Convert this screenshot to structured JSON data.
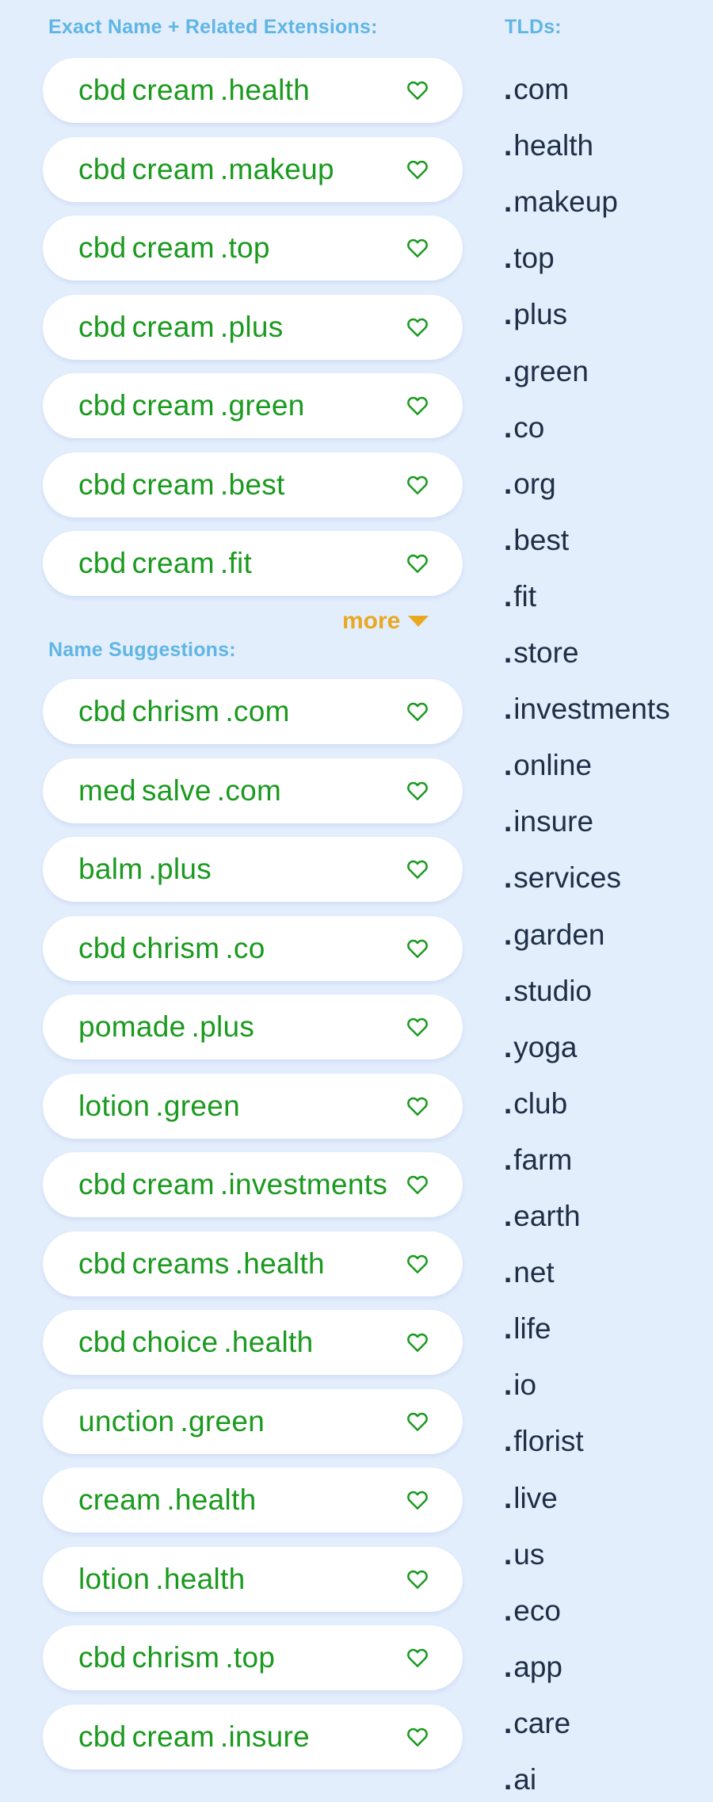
{
  "exact_section": {
    "heading": "Exact Name + Related Extensions:",
    "items": [
      {
        "name": "cbd",
        "name2": "cream",
        "ext": ".health"
      },
      {
        "name": "cbd",
        "name2": "cream",
        "ext": ".makeup"
      },
      {
        "name": "cbd",
        "name2": "cream",
        "ext": ".top"
      },
      {
        "name": "cbd",
        "name2": "cream",
        "ext": ".plus"
      },
      {
        "name": "cbd",
        "name2": "cream",
        "ext": ".green"
      },
      {
        "name": "cbd",
        "name2": "cream",
        "ext": ".best"
      },
      {
        "name": "cbd",
        "name2": "cream",
        "ext": ".fit"
      }
    ],
    "more_label": "more"
  },
  "suggestions_section": {
    "heading": "Name Suggestions:",
    "items": [
      {
        "name": "cbd",
        "name2": "chrism",
        "ext": ".com"
      },
      {
        "name": "med",
        "name2": "salve",
        "ext": ".com"
      },
      {
        "name": "balm",
        "name2": "",
        "ext": ".plus"
      },
      {
        "name": "cbd",
        "name2": "chrism",
        "ext": ".co"
      },
      {
        "name": "pomade",
        "name2": "",
        "ext": ".plus"
      },
      {
        "name": "lotion",
        "name2": "",
        "ext": ".green"
      },
      {
        "name": "cbd",
        "name2": "cream",
        "ext": ".investments"
      },
      {
        "name": "cbd",
        "name2": "creams",
        "ext": ".health"
      },
      {
        "name": "cbd",
        "name2": "choice",
        "ext": ".health"
      },
      {
        "name": "unction",
        "name2": "",
        "ext": ".green"
      },
      {
        "name": "cream",
        "name2": "",
        "ext": ".health"
      },
      {
        "name": "lotion",
        "name2": "",
        "ext": ".health"
      },
      {
        "name": "cbd",
        "name2": "chrism",
        "ext": ".top"
      },
      {
        "name": "cbd",
        "name2": "cream",
        "ext": ".insure"
      }
    ]
  },
  "tlds_section": {
    "heading": "TLDs:",
    "dot": ".",
    "items": [
      "com",
      "health",
      "makeup",
      "top",
      "plus",
      "green",
      "co",
      "org",
      "best",
      "fit",
      "store",
      "investments",
      "online",
      "insure",
      "services",
      "garden",
      "studio",
      "yoga",
      "club",
      "farm",
      "earth",
      "net",
      "life",
      "io",
      "florist",
      "live",
      "us",
      "eco",
      "app",
      "care",
      "ai"
    ]
  },
  "icons": {
    "favorite": "heart-outline-icon",
    "more": "caret-down-icon"
  },
  "colors": {
    "background": "#e3eefd",
    "heading": "#5fb6e4",
    "domain_text": "#1a9a1e",
    "heart": "#1a9a1e",
    "more": "#e9a820",
    "tld_text": "#1e2f45",
    "card": "#ffffff"
  }
}
